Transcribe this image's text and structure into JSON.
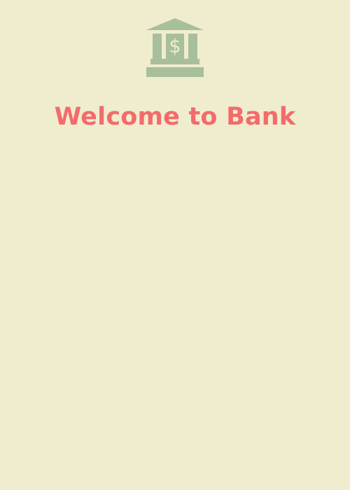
{
  "app": {
    "welcome_title": "Welcome to Bank",
    "logo_icon": "bank-icon",
    "colors": {
      "background": "#f0edcf",
      "title": "#f36b6b",
      "icon": "#a8bf9c",
      "icon_symbol": "#f0edcf"
    }
  }
}
